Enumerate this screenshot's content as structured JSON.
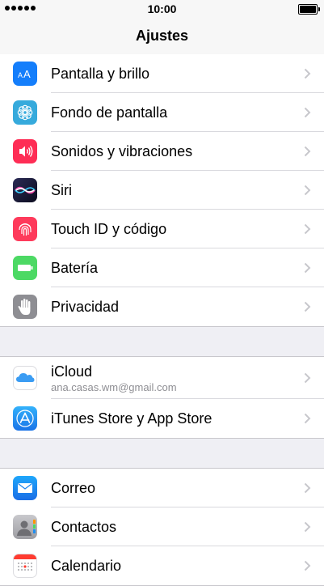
{
  "status_bar": {
    "time": "10:00"
  },
  "nav": {
    "title": "Ajustes"
  },
  "groups": [
    [
      {
        "label": "Pantalla y brillo",
        "icon": "display-brightness-icon",
        "color": "#147efb"
      },
      {
        "label": "Fondo de pantalla",
        "icon": "wallpaper-flower-icon",
        "color": "#36aadc"
      },
      {
        "label": "Sonidos y vibraciones",
        "icon": "sound-speaker-icon",
        "color": "#fe2d55"
      },
      {
        "label": "Siri",
        "icon": "siri-icon",
        "color": "#1b1b3a"
      },
      {
        "label": "Touch ID y código",
        "icon": "fingerprint-icon",
        "color": "#fe3a5b"
      },
      {
        "label": "Batería",
        "icon": "battery-icon",
        "color": "#4cd964"
      },
      {
        "label": "Privacidad",
        "icon": "hand-privacy-icon",
        "color": "#8e8e93"
      }
    ],
    [
      {
        "label": "iCloud",
        "sublabel": "ana.casas.wm@gmail.com",
        "icon": "icloud-icon",
        "color": "#ffffff"
      },
      {
        "label": "iTunes Store y App Store",
        "icon": "app-store-icon",
        "color": "#1f8ef1"
      }
    ],
    [
      {
        "label": "Correo",
        "icon": "mail-envelope-icon",
        "color": "#1f8ef1"
      },
      {
        "label": "Contactos",
        "icon": "contacts-icon",
        "color": "#b0b0b4"
      },
      {
        "label": "Calendario",
        "icon": "calendar-icon",
        "color": "#ffffff"
      }
    ]
  ]
}
